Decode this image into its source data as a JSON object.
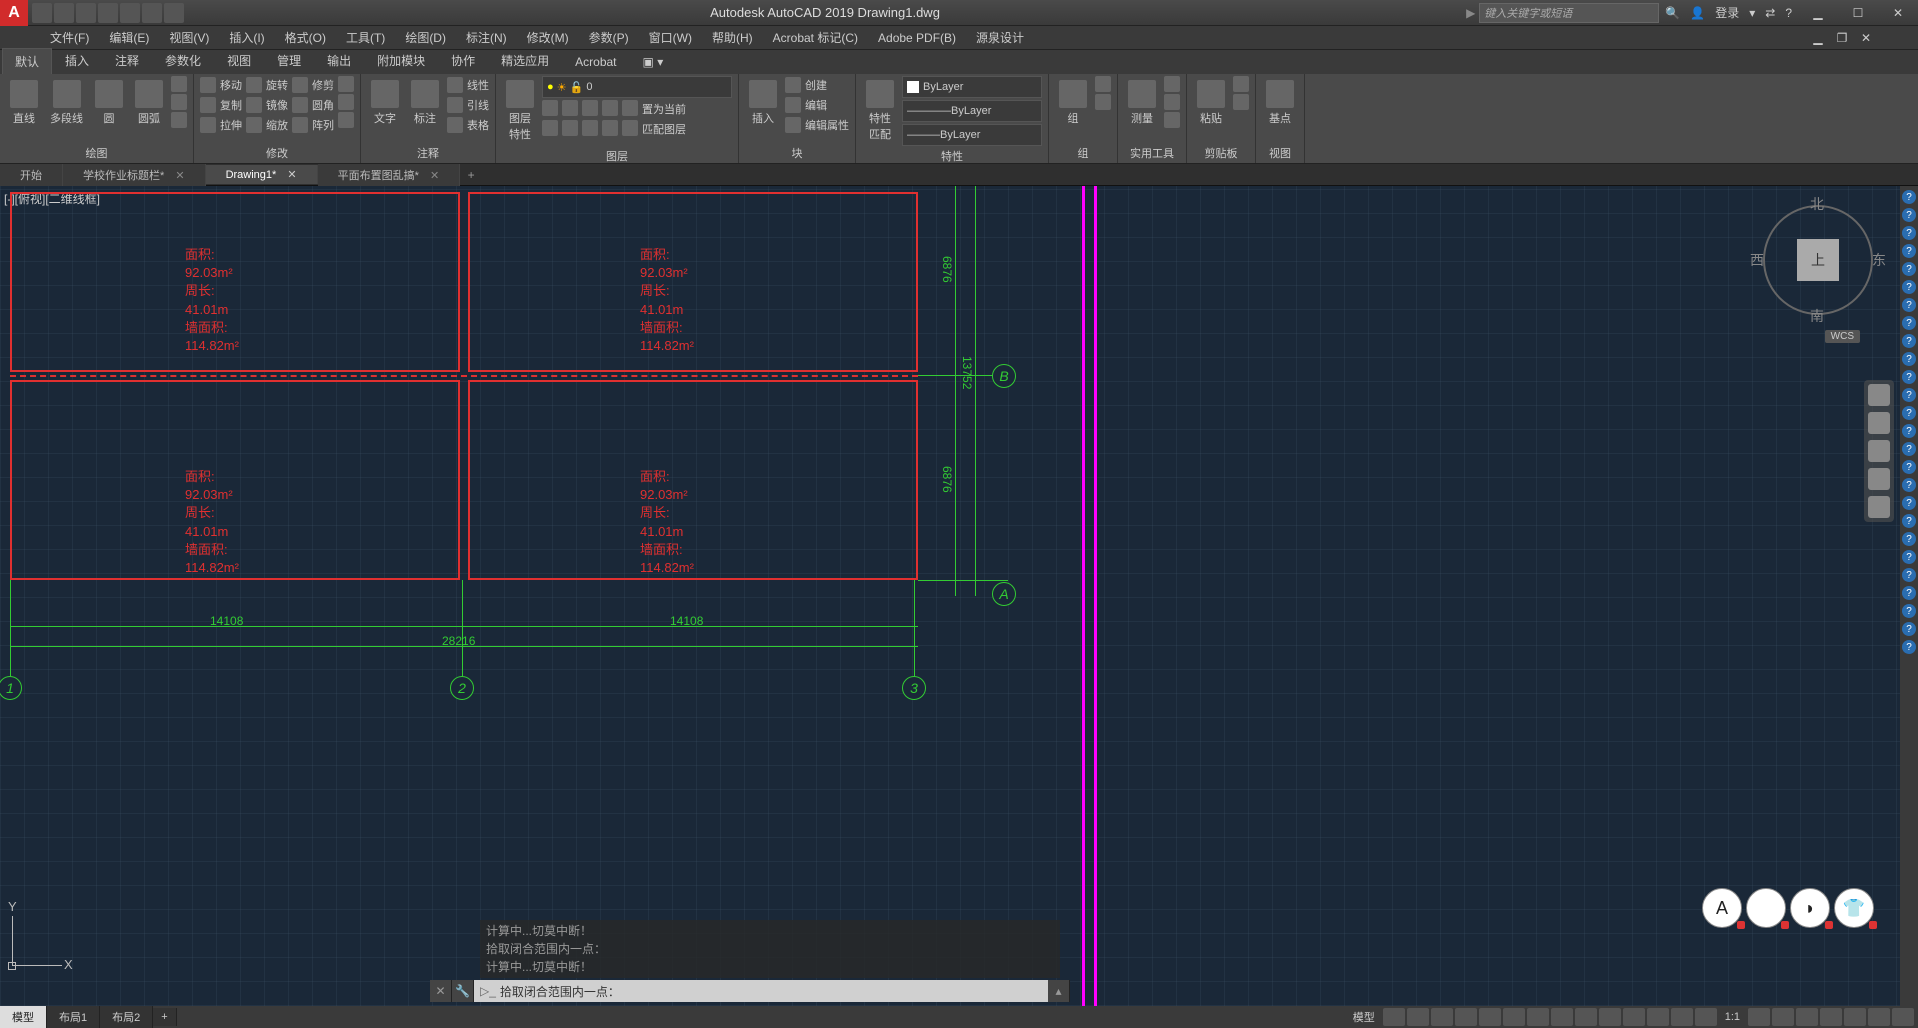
{
  "title": "Autodesk AutoCAD 2019   Drawing1.dwg",
  "searchPlaceholder": "键入关键字或短语",
  "login": "登录",
  "menus": [
    "文件(F)",
    "编辑(E)",
    "视图(V)",
    "插入(I)",
    "格式(O)",
    "工具(T)",
    "绘图(D)",
    "标注(N)",
    "修改(M)",
    "参数(P)",
    "窗口(W)",
    "帮助(H)",
    "Acrobat 标记(C)",
    "Adobe PDF(B)",
    "源泉设计"
  ],
  "ribbonTabs": [
    "默认",
    "插入",
    "注释",
    "参数化",
    "视图",
    "管理",
    "输出",
    "附加模块",
    "协作",
    "精选应用",
    "Acrobat"
  ],
  "activeRibbonTab": 0,
  "ribbon": {
    "draw": {
      "title": "绘图",
      "btns": [
        "直线",
        "多段线",
        "圆",
        "圆弧"
      ]
    },
    "modify": {
      "title": "修改",
      "move": "移动",
      "copy": "复制",
      "stretch": "拉伸",
      "rotate": "旋转",
      "mirror": "镜像",
      "scale": "缩放",
      "trim": "修剪",
      "fillet": "圆角",
      "array": "阵列"
    },
    "annot": {
      "title": "注释",
      "text": "文字",
      "dim": "标注",
      "linear": "线性",
      "leader": "引线",
      "table": "表格"
    },
    "layer": {
      "title": "图层",
      "props": "图层\n特性",
      "current": "0",
      "makecur": "置为当前",
      "match": "匹配图层"
    },
    "block": {
      "title": "块",
      "insert": "插入",
      "create": "创建",
      "edit": "编辑",
      "attr": "编辑属性"
    },
    "props": {
      "title": "特性",
      "match": "特性\n匹配",
      "bylayer": "ByLayer"
    },
    "group": {
      "title": "组",
      "label": "组"
    },
    "util": {
      "title": "实用工具",
      "measure": "测量"
    },
    "clip": {
      "title": "剪贴板",
      "paste": "粘贴"
    },
    "view": {
      "title": "视图",
      "base": "基点"
    }
  },
  "fileTabs": [
    "开始",
    "学校作业标题栏*",
    "Drawing1*",
    "平面布置图乱搞*"
  ],
  "activeFileTab": 2,
  "viewportLabel": "[-][俯视][二维线框]",
  "roomInfo": {
    "area_label": "面积:",
    "area_val": "92.03m²",
    "perim_label": "周长:",
    "perim_val": "41.01m",
    "wall_label": "墙面积:",
    "wall_val": "114.82m²"
  },
  "dims": {
    "w_half": "14108",
    "w_full": "28216",
    "h_half": "6876",
    "h_full": "13752"
  },
  "gridLabels": {
    "a": "A",
    "b": "B",
    "g1": "1",
    "g2": "2",
    "g3": "3"
  },
  "viewCube": {
    "top": "上",
    "n": "北",
    "s": "南",
    "e": "东",
    "w": "西",
    "wcs": "WCS"
  },
  "cmdHistory": [
    "计算中...切莫中断！",
    "拾取闭合范围内一点：",
    "计算中...切莫中断！"
  ],
  "cmdPrompt": "拾取闭合范围内一点：",
  "layoutTabs": [
    "模型",
    "布局1",
    "布局2"
  ],
  "activeLayoutTab": 0,
  "statusRight": {
    "model": "模型",
    "scale": "1:1"
  },
  "ucs": {
    "x": "X",
    "y": "Y"
  }
}
